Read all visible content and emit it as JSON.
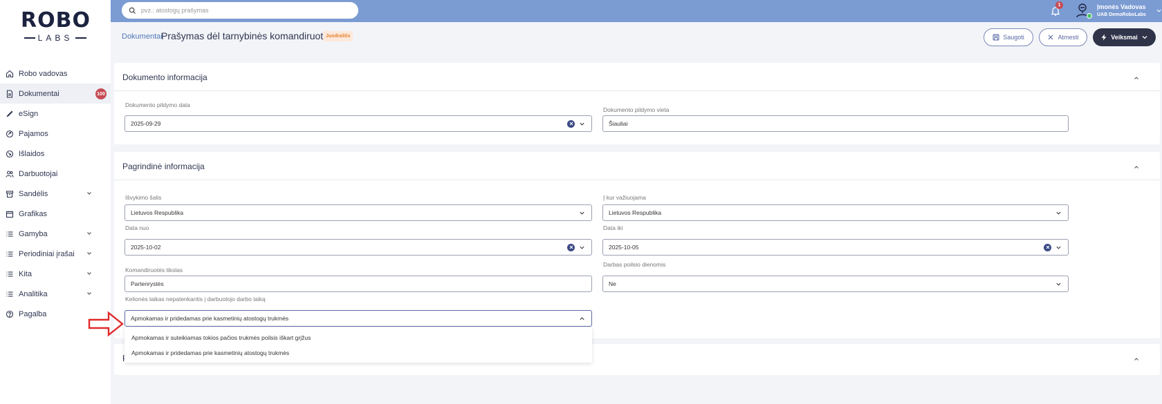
{
  "logo": {
    "top": "ROBO",
    "bottom": "LABS"
  },
  "sidebar": {
    "items": [
      {
        "label": "Robo vadovas",
        "icon": "home-icon"
      },
      {
        "label": "Dokumentai",
        "icon": "document-icon",
        "badge": "100",
        "active": true
      },
      {
        "label": "eSign",
        "icon": "pen-icon"
      },
      {
        "label": "Pajamos",
        "icon": "income-icon"
      },
      {
        "label": "Išlaidos",
        "icon": "expense-icon"
      },
      {
        "label": "Darbuotojai",
        "icon": "users-icon"
      },
      {
        "label": "Sandėlis",
        "icon": "warehouse-icon",
        "expandable": true
      },
      {
        "label": "Grafikas",
        "icon": "calendar-icon"
      },
      {
        "label": "Gamyba",
        "icon": "list-icon",
        "expandable": true
      },
      {
        "label": "Periodiniai įrašai",
        "icon": "list-icon",
        "expandable": true
      },
      {
        "label": "Kita",
        "icon": "list-icon",
        "expandable": true
      },
      {
        "label": "Analitika",
        "icon": "list-icon",
        "expandable": true
      },
      {
        "label": "Pagalba",
        "icon": "help-icon"
      }
    ]
  },
  "topbar": {
    "search_placeholder": "pvz.: atostogų prašymas",
    "notifications_count": "1",
    "user_name": "Įmonės Vadovas",
    "user_company": "UAB DemoRoboLabs"
  },
  "header": {
    "breadcrumb": "Dokumentai",
    "title": "Prašymas dėl tarnybinės komandiruotės",
    "status": "Juodraštis",
    "save_label": "Saugoti",
    "reject_label": "Atmesti",
    "actions_label": "Veiksmai"
  },
  "doc_info": {
    "title": "Dokumento informacija",
    "date_label": "Dokumento pildymo data",
    "date_value": "2025-09-29",
    "place_label": "Dokumento pildymo vieta",
    "place_value": "Šiauliai"
  },
  "main_info": {
    "title": "Pagrindinė informacija",
    "country_label": "Išvykimo šalis",
    "country_value": "Lietuvos Respublika",
    "destination_label": "Į kur važiuojama",
    "destination_value": "Lietuvos Respublika",
    "date_from_label": "Data nuo",
    "date_from_value": "2025-10-02",
    "date_to_label": "Data iki",
    "date_to_value": "2025-10-05",
    "purpose_label": "Komandiruotės tikslas",
    "purpose_value": "Partenrystės",
    "weekend_label": "Darbas poilsio dienomis",
    "weekend_value": "Ne",
    "travel_time_label": "Kelionės laikas nepatenkantis į darbuotojo darbo laiką",
    "travel_time_value": "Apmokamas ir pridedamas prie kasmetinių atostogų trukmės",
    "travel_time_options": [
      "Apmokamas ir suteikiamas tokios pačios trukmės poilsis iškart grįžus",
      "Apmokamas ir pridedamas prie kasmetinių atostogų trukmės"
    ]
  },
  "third_card": {
    "title_fragment": "F"
  },
  "colors": {
    "topbar": "#7b9bd3",
    "accent": "#3b4a86",
    "badge_red": "#c64b54",
    "draft_orange": "#e3832d",
    "arrow_red": "#e02a2a"
  }
}
